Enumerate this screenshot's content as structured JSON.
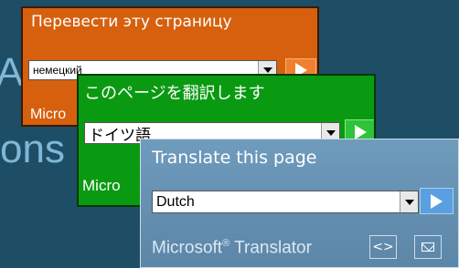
{
  "background": {
    "color": "#1e4e66",
    "fragment_a": "A",
    "fragment_ons": "ons"
  },
  "widgets": [
    {
      "title": "Перевести эту страницу",
      "language": "немецкий",
      "footer": "Micro",
      "color": "#d6600e"
    },
    {
      "title": "このページを翻訳します",
      "language": "ドイツ語",
      "footer": "Micro",
      "color": "#0a9a12"
    },
    {
      "title": "Translate this page",
      "language": "Dutch",
      "footer_brand": "Microsoft",
      "footer_reg": "®",
      "footer_product": "Translator",
      "embed_icon": "code-brackets-icon",
      "email_icon": "envelope-icon",
      "color": "#5c86a8"
    }
  ]
}
